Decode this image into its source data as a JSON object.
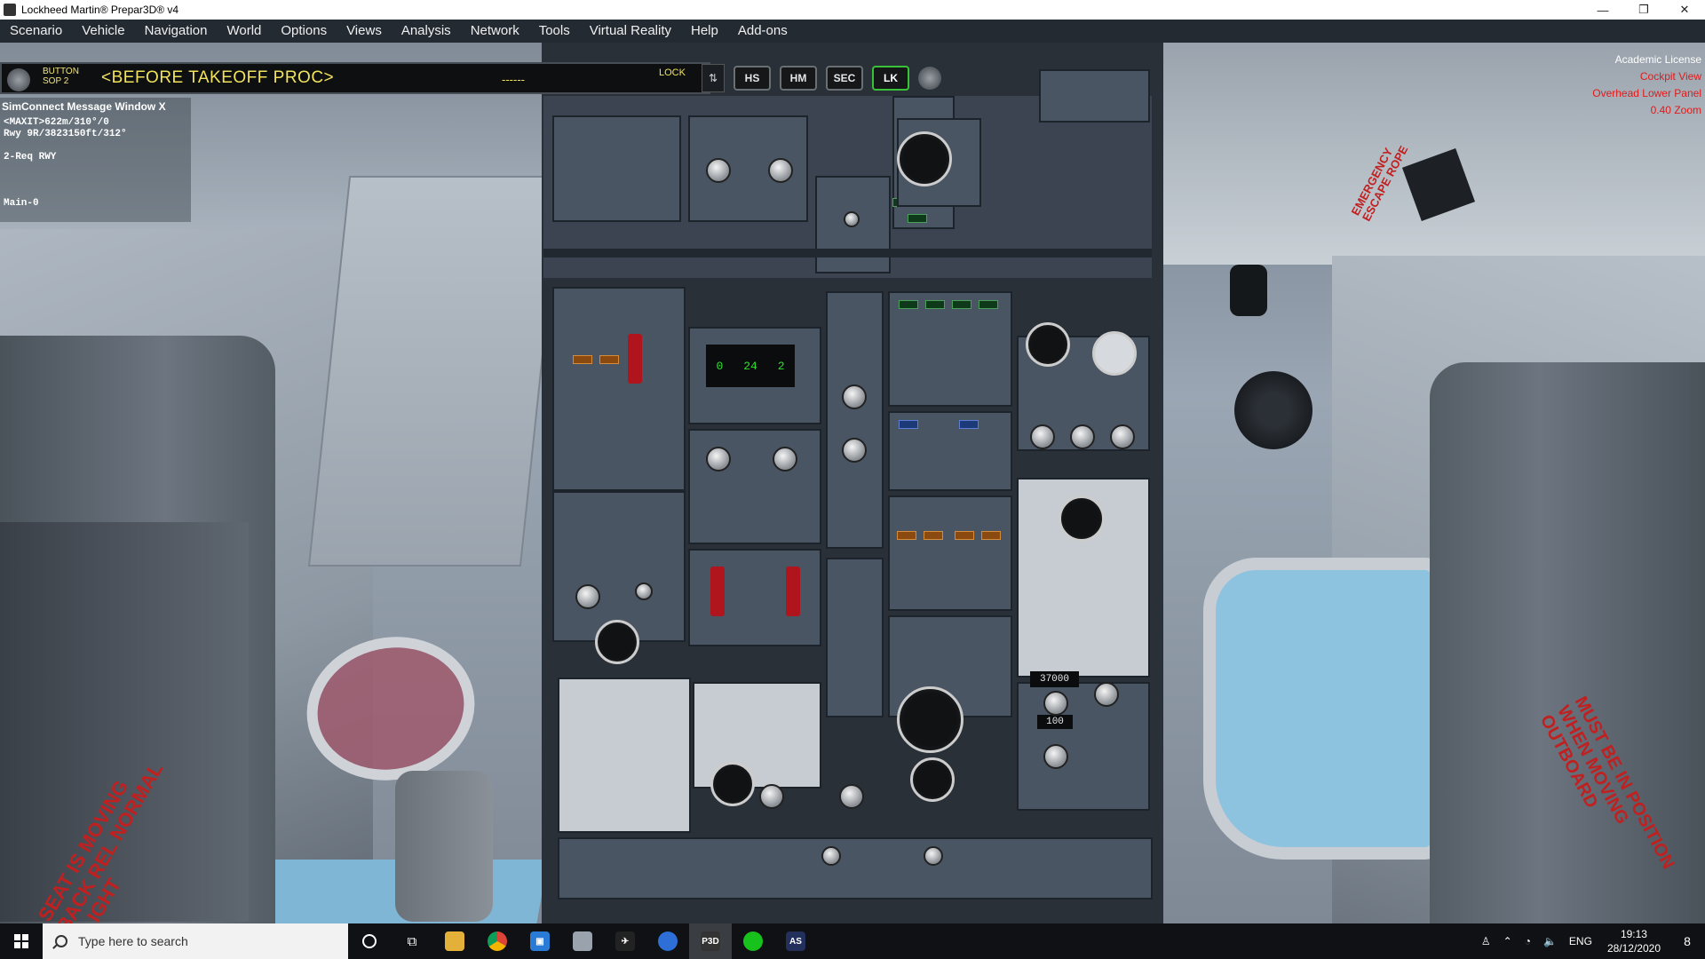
{
  "window": {
    "title": "Lockheed Martin® Prepar3D® v4",
    "minimize": "—",
    "restore": "❐",
    "close": "✕"
  },
  "menu": [
    "Scenario",
    "Vehicle",
    "Navigation",
    "World",
    "Options",
    "Views",
    "Analysis",
    "Network",
    "Tools",
    "Virtual Reality",
    "Help",
    "Add-ons"
  ],
  "instrument_bar": {
    "label_line1": "BUTTON",
    "label_line2": "SOP 2",
    "procedure": "<BEFORE TAKEOFF PROC>",
    "dashes": "------",
    "lock": "LOCK",
    "buttons": [
      "HS",
      "HM",
      "SEC",
      "LK"
    ],
    "active_button": "LK"
  },
  "simconnect": {
    "title": "SimConnect Message Window X",
    "lines": [
      "<MAXIT>622m/310°/0",
      "Rwy 9R/3823150ft/312°",
      "",
      "2-Req RWY",
      "",
      "",
      "Main-0"
    ]
  },
  "overlay": {
    "license": "Academic License",
    "views": [
      "Cockpit View",
      "Overhead Lower Panel",
      "0.40 Zoom"
    ],
    "license_color": "#ffffff",
    "view_color": "#e01b1b"
  },
  "panel": {
    "altitude_display": "37000",
    "landing_alt_display": "100",
    "dc_amps_value": "0",
    "dc_volts_value": "24",
    "ac_value": "2"
  },
  "wall_labels": {
    "escape_rope": "EMERGENCY ESCAPE ROPE",
    "seat_warning": "SEAT IS MOVING BACK REL NORMAL FLIGHT",
    "outboard": "MUST BE IN POSITION WHEN MOVING OUTBOARD"
  },
  "taskbar": {
    "search_placeholder": "Type here to search",
    "apps": [
      "cortana",
      "task-view",
      "file-explorer",
      "chrome",
      "remote-desktop",
      "app-generic",
      "flight-app",
      "globe",
      "p3d",
      "radar",
      "active-sky"
    ],
    "tray": [
      "person-icon",
      "chevron-up",
      "network",
      "volume",
      "ENG"
    ],
    "time": "19:13",
    "date": "28/12/2020",
    "notifications": "8"
  }
}
